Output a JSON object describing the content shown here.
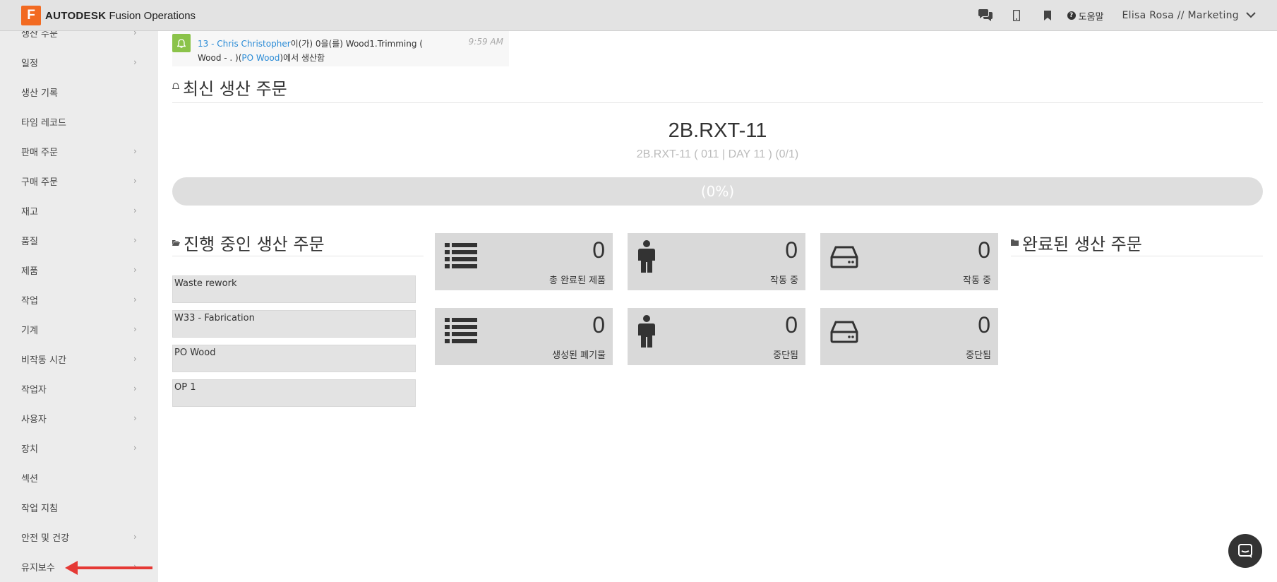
{
  "header": {
    "brand_logo": "F",
    "brand_strong": "AUTODESK",
    "brand_product": "Fusion Operations",
    "icons": [
      "chat-icon",
      "mobile-icon",
      "bookmark-icon"
    ],
    "help_label": "도움말",
    "user": "Elisa Rosa // Marketing"
  },
  "sidebar": {
    "items": [
      {
        "label": "생산 주문",
        "chevron": true
      },
      {
        "label": "일정",
        "chevron": true
      },
      {
        "label": "생산 기록",
        "chevron": false
      },
      {
        "label": "타임 레코드",
        "chevron": false
      },
      {
        "label": "판매 주문",
        "chevron": true
      },
      {
        "label": "구매 주문",
        "chevron": true
      },
      {
        "label": "재고",
        "chevron": true
      },
      {
        "label": "품질",
        "chevron": true
      },
      {
        "label": "제품",
        "chevron": true
      },
      {
        "label": "작업",
        "chevron": true
      },
      {
        "label": "기계",
        "chevron": true
      },
      {
        "label": "비작동 시간",
        "chevron": true
      },
      {
        "label": "작업자",
        "chevron": true
      },
      {
        "label": "사용자",
        "chevron": true
      },
      {
        "label": "장치",
        "chevron": true
      },
      {
        "label": "섹션",
        "chevron": false
      },
      {
        "label": "작업 지침",
        "chevron": false
      },
      {
        "label": "안전 및 건강",
        "chevron": true
      },
      {
        "label": "유지보수",
        "chevron": true
      }
    ],
    "highlight_arrow_color": "#e53935"
  },
  "notification": {
    "link1": "13 - Chris Christopher",
    "text1": "이(가) 0을(를) Wood1.Trimming (",
    "text2": "Wood - . )(",
    "link2": "PO Wood",
    "text3": ")에서 생산함",
    "time": "9:59 AM"
  },
  "latest": {
    "heading": "최신 생산 주문",
    "order_title": "2B.RXT-11",
    "order_sub": "2B.RXT-11 ( 011 | DAY 11 ) (0/1)",
    "progress_label": "(0%)",
    "progress_value": 0
  },
  "in_progress": {
    "heading": "진행 중인 생산 주문",
    "items": [
      "Waste rework",
      "W33 - Fabrication",
      "PO Wood",
      "OP 1"
    ]
  },
  "tiles": [
    {
      "icon": "list-icon",
      "value": "0",
      "label": "총 완료된 제품"
    },
    {
      "icon": "person-icon",
      "value": "0",
      "label": "작동 중"
    },
    {
      "icon": "hard-drive-icon",
      "value": "0",
      "label": "작동 중"
    },
    {
      "icon": "list-icon",
      "value": "0",
      "label": "생성된 폐기물"
    },
    {
      "icon": "person-icon",
      "value": "0",
      "label": "중단됨"
    },
    {
      "icon": "hard-drive-icon",
      "value": "0",
      "label": "중단됨"
    }
  ],
  "completed": {
    "heading": "완료된 생산 주문"
  },
  "colors": {
    "brand": "#f26a21",
    "link": "#2a8bd6",
    "notif_badge": "#8bc34a",
    "topbar": "#e3e3e3",
    "sidebar": "#ececec",
    "tile": "#d9d9d9"
  }
}
